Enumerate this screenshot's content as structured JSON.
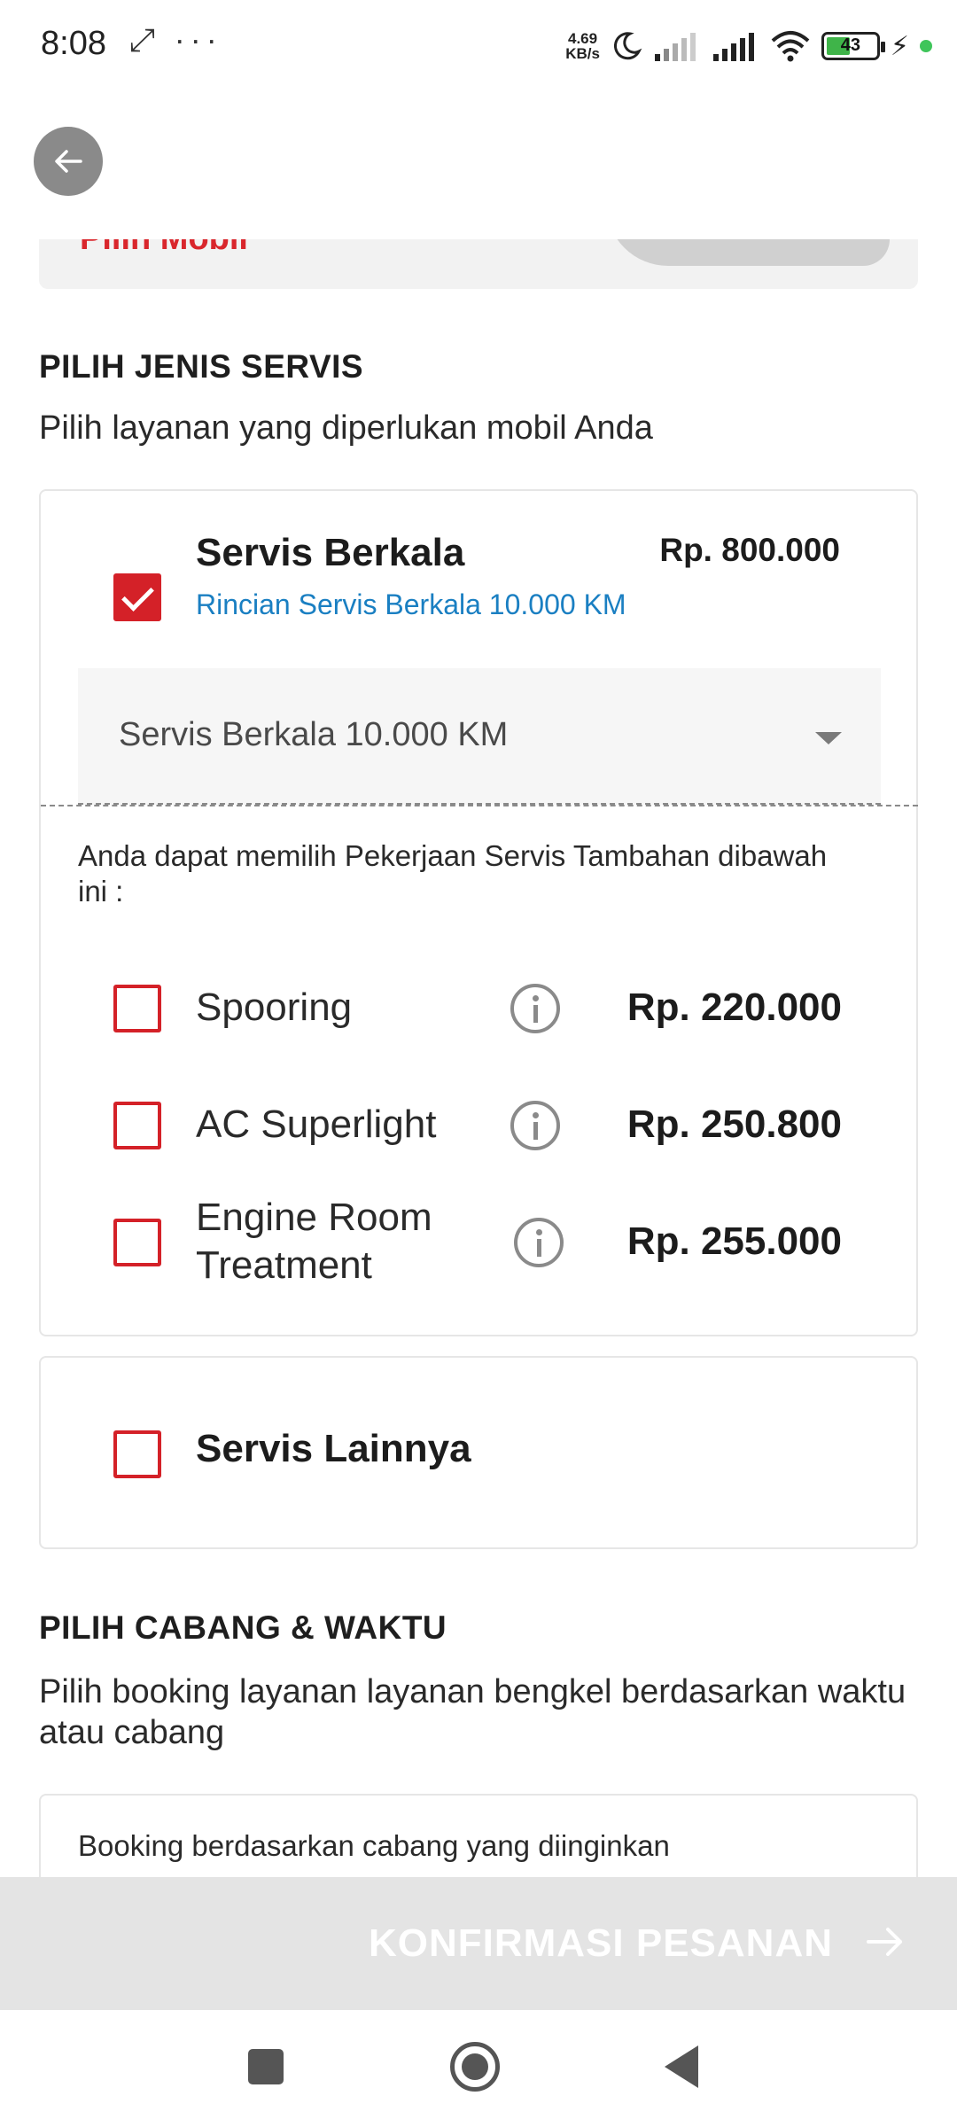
{
  "status_bar": {
    "time": "8:08",
    "extra_icons": "⤢ ···",
    "net_speed_value": "4.69",
    "net_speed_unit": "KB/s",
    "battery_level": "43",
    "charging_icon": "bolt-icon"
  },
  "header": {
    "back_icon": "arrow-left-icon"
  },
  "car_card": {
    "partial_text": "Pilih Mobil"
  },
  "service_type": {
    "title": "PILIH JENIS SERVIS",
    "subtitle": "Pilih layanan yang diperlukan mobil Anda",
    "periodic": {
      "name": "Servis Berkala",
      "price": "Rp. 800.000",
      "details_link": "Rincian Servis Berkala 10.000 KM",
      "checked": true,
      "selected_option": "Servis Berkala 10.000 KM"
    },
    "addons_note": "Anda dapat memilih Pekerjaan Servis Tambahan dibawah ini :",
    "addons": [
      {
        "label": "Spooring",
        "price": "Rp. 220.000",
        "checked": false
      },
      {
        "label": "AC Superlight",
        "price": "Rp. 250.800",
        "checked": false
      },
      {
        "label": "Engine Room Treatment",
        "price": "Rp. 255.000",
        "checked": false
      }
    ],
    "other": {
      "name": "Servis Lainnya",
      "checked": false
    }
  },
  "branch_time": {
    "title": "PILIH CABANG & WAKTU",
    "subtitle": "Pilih booking layanan layanan bengkel berdasarkan waktu atau cabang",
    "option_branch": "Booking berdasarkan cabang yang diinginkan"
  },
  "confirm": {
    "label": "KONFIRMASI PESANAN"
  },
  "colors": {
    "accent_red": "#d42128",
    "link_blue": "#1a7fc2",
    "disabled_bar": "#e4e4e4"
  }
}
